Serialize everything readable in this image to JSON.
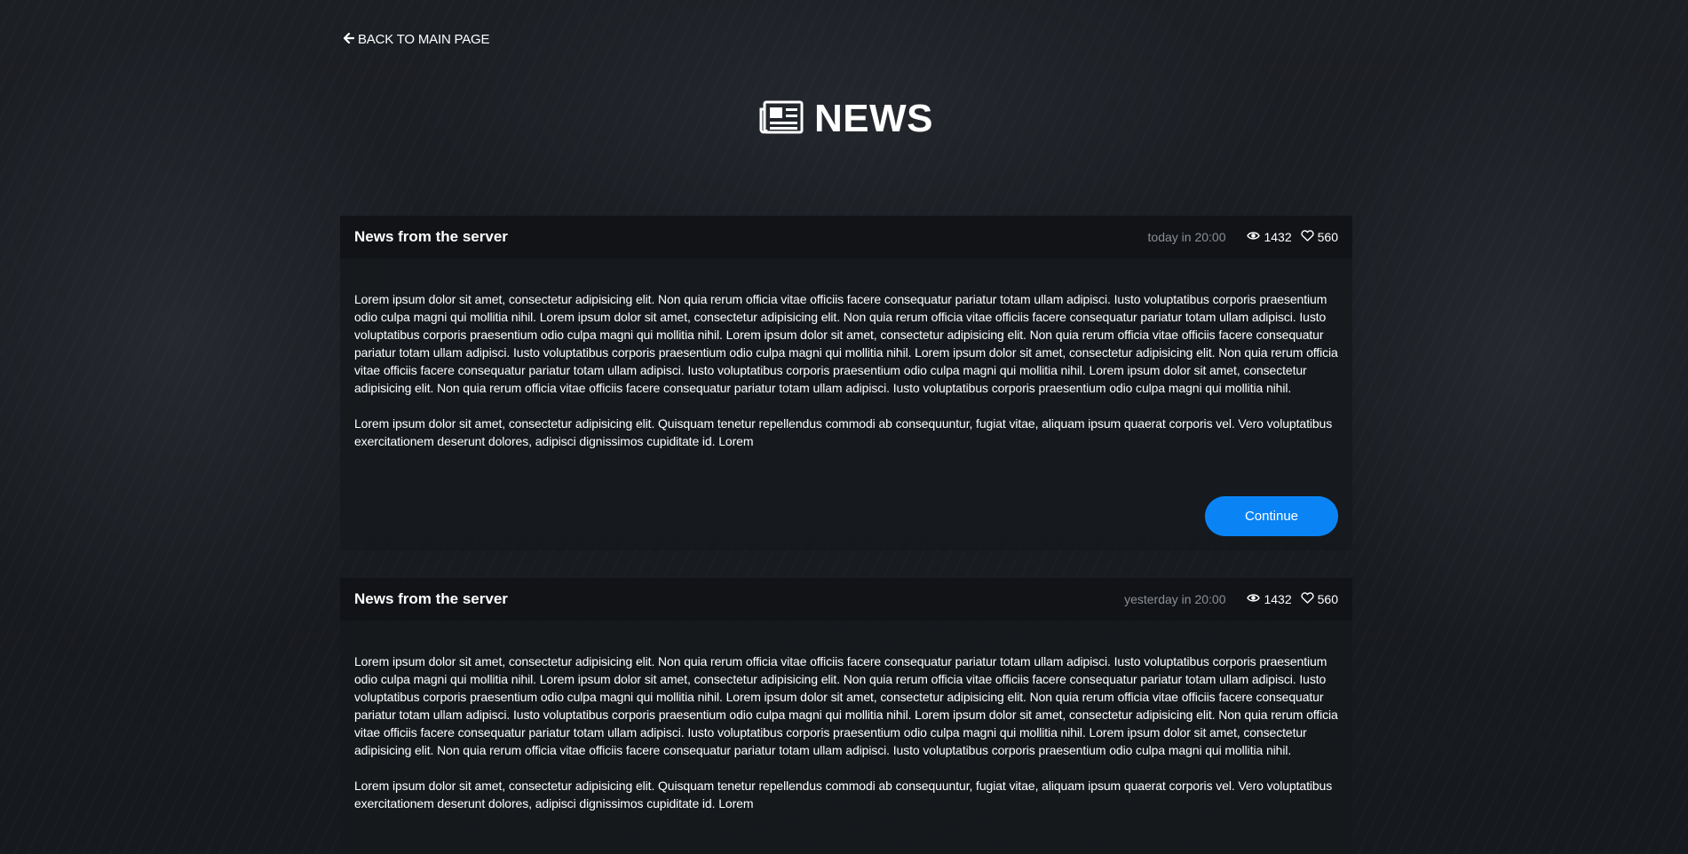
{
  "nav": {
    "back_label": "BACK TO MAIN PAGE",
    "back_icon": "arrow-left-icon"
  },
  "page": {
    "title": "NEWS",
    "title_icon": "newspaper-icon"
  },
  "colors": {
    "accent": "#0a84f5",
    "card_header_bg": "#111316",
    "meta_gray": "#8a8f96"
  },
  "news": [
    {
      "title": "News from the server",
      "date": "today in 20:00",
      "views": "1432",
      "likes": "560",
      "paragraphs": [
        "Lorem ipsum dolor sit amet, consectetur adipisicing elit. Non quia rerum officia vitae officiis facere consequatur pariatur totam ullam adipisci. Iusto voluptatibus corporis praesentium odio culpa magni qui mollitia nihil. Lorem ipsum dolor sit amet, consectetur adipisicing elit. Non quia rerum officia vitae officiis facere consequatur pariatur totam ullam adipisci. Iusto voluptatibus corporis praesentium odio culpa magni qui mollitia nihil. Lorem ipsum dolor sit amet, consectetur adipisicing elit. Non quia rerum officia vitae officiis facere consequatur pariatur totam ullam adipisci. Iusto voluptatibus corporis praesentium odio culpa magni qui mollitia nihil. Lorem ipsum dolor sit amet, consectetur adipisicing elit. Non quia rerum officia vitae officiis facere consequatur pariatur totam ullam adipisci. Iusto voluptatibus corporis praesentium odio culpa magni qui mollitia nihil. Lorem ipsum dolor sit amet, consectetur adipisicing elit. Non quia rerum officia vitae officiis facere consequatur pariatur totam ullam adipisci. Iusto voluptatibus corporis praesentium odio culpa magni qui mollitia nihil.",
        "Lorem ipsum dolor sit amet, consectetur adipisicing elit. Quisquam tenetur repellendus commodi ab consequuntur, fugiat vitae, aliquam ipsum quaerat corporis vel. Vero voluptatibus exercitationem deserunt dolores, adipisci dignissimos cupiditate id. Lorem"
      ],
      "button_label": "Continue"
    },
    {
      "title": "News from the server",
      "date": "yesterday in 20:00",
      "views": "1432",
      "likes": "560",
      "paragraphs": [
        "Lorem ipsum dolor sit amet, consectetur adipisicing elit. Non quia rerum officia vitae officiis facere consequatur pariatur totam ullam adipisci. Iusto voluptatibus corporis praesentium odio culpa magni qui mollitia nihil. Lorem ipsum dolor sit amet, consectetur adipisicing elit. Non quia rerum officia vitae officiis facere consequatur pariatur totam ullam adipisci. Iusto voluptatibus corporis praesentium odio culpa magni qui mollitia nihil. Lorem ipsum dolor sit amet, consectetur adipisicing elit. Non quia rerum officia vitae officiis facere consequatur pariatur totam ullam adipisci. Iusto voluptatibus corporis praesentium odio culpa magni qui mollitia nihil. Lorem ipsum dolor sit amet, consectetur adipisicing elit. Non quia rerum officia vitae officiis facere consequatur pariatur totam ullam adipisci. Iusto voluptatibus corporis praesentium odio culpa magni qui mollitia nihil. Lorem ipsum dolor sit amet, consectetur adipisicing elit. Non quia rerum officia vitae officiis facere consequatur pariatur totam ullam adipisci. Iusto voluptatibus corporis praesentium odio culpa magni qui mollitia nihil.",
        "Lorem ipsum dolor sit amet, consectetur adipisicing elit. Quisquam tenetur repellendus commodi ab consequuntur, fugiat vitae, aliquam ipsum quaerat corporis vel. Vero voluptatibus exercitationem deserunt dolores, adipisci dignissimos cupiditate id. Lorem"
      ]
    }
  ]
}
